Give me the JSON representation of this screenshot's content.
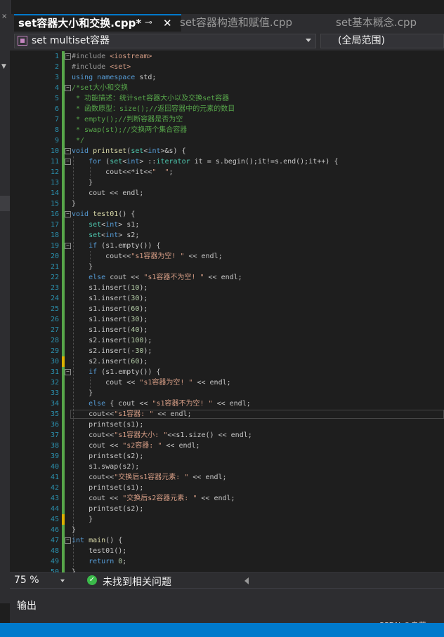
{
  "tabs": [
    {
      "label": "set容器大小和交换.cpp*",
      "active": true
    },
    {
      "label": "set容器构造和赋值.cpp",
      "active": false
    },
    {
      "label": "set基本概念.cpp",
      "active": false
    }
  ],
  "tab_pin_icon": "⊸",
  "tab_close_icon": "✕",
  "nav": {
    "scope_label": "set multiset容器",
    "global_scope": "(全局范围)"
  },
  "editor": {
    "zoom": "75 %",
    "issues_text": "未找到相关问题",
    "changed_lines": [
      30,
      45
    ],
    "current_line": 35
  },
  "code_lines": [
    [
      [
        "p",
        "#include "
      ],
      [
        "s",
        "<iostream>"
      ]
    ],
    [
      [
        "p",
        "#include "
      ],
      [
        "s",
        "<set>"
      ]
    ],
    [
      [
        "k",
        "using"
      ],
      [
        "m",
        " "
      ],
      [
        "k",
        "namespace"
      ],
      [
        "m",
        " std;"
      ]
    ],
    [
      [
        "c",
        "/*set大小和交换"
      ]
    ],
    [
      [
        "c",
        " * 功能描述：统计set容器大小以及交换set容器"
      ]
    ],
    [
      [
        "c",
        " * 函数原型：size();//返回容器中的元素的数目"
      ]
    ],
    [
      [
        "c",
        " * empty();//判断容器是否为空"
      ]
    ],
    [
      [
        "c",
        " * swap(st);//交换两个集合容器"
      ]
    ],
    [
      [
        "c",
        " */"
      ]
    ],
    [
      [
        "k",
        "void"
      ],
      [
        "m",
        " "
      ],
      [
        "f",
        "printset"
      ],
      [
        "m",
        "("
      ],
      [
        "t",
        "set"
      ],
      [
        "m",
        "<"
      ],
      [
        "k",
        "int"
      ],
      [
        "m",
        ">&s) {"
      ]
    ],
    [
      [
        "m",
        "    "
      ],
      [
        "k",
        "for"
      ],
      [
        "m",
        " ("
      ],
      [
        "t",
        "set"
      ],
      [
        "m",
        "<"
      ],
      [
        "k",
        "int"
      ],
      [
        "m",
        "> ::"
      ],
      [
        "t",
        "iterator"
      ],
      [
        "m",
        " it = s.begin();it!=s.end();it++) {"
      ]
    ],
    [
      [
        "m",
        "        cout<<*it<<"
      ],
      [
        "s",
        "\"  \""
      ],
      [
        "m",
        ";"
      ]
    ],
    [
      [
        "m",
        "    }"
      ]
    ],
    [
      [
        "m",
        "    cout << endl;"
      ]
    ],
    [
      [
        "m",
        "}"
      ]
    ],
    [
      [
        "k",
        "void"
      ],
      [
        "m",
        " "
      ],
      [
        "f",
        "test01"
      ],
      [
        "m",
        "() {"
      ]
    ],
    [
      [
        "m",
        "    "
      ],
      [
        "t",
        "set"
      ],
      [
        "m",
        "<"
      ],
      [
        "k",
        "int"
      ],
      [
        "m",
        "> s1;"
      ]
    ],
    [
      [
        "m",
        "    "
      ],
      [
        "t",
        "set"
      ],
      [
        "m",
        "<"
      ],
      [
        "k",
        "int"
      ],
      [
        "m",
        "> s2;"
      ]
    ],
    [
      [
        "m",
        "    "
      ],
      [
        "k",
        "if"
      ],
      [
        "m",
        " (s1.empty()) {"
      ]
    ],
    [
      [
        "m",
        "        cout<<"
      ],
      [
        "s",
        "\"s1容器为空! \""
      ],
      [
        "m",
        " << endl;"
      ]
    ],
    [
      [
        "m",
        "    }"
      ]
    ],
    [
      [
        "m",
        "    "
      ],
      [
        "k",
        "else"
      ],
      [
        "m",
        " cout << "
      ],
      [
        "s",
        "\"s1容器不为空! \""
      ],
      [
        "m",
        " << endl;"
      ]
    ],
    [
      [
        "m",
        "    s1.insert("
      ],
      [
        "n",
        "10"
      ],
      [
        "m",
        ");"
      ]
    ],
    [
      [
        "m",
        "    s1.insert("
      ],
      [
        "n",
        "30"
      ],
      [
        "m",
        ");"
      ]
    ],
    [
      [
        "m",
        "    s1.insert("
      ],
      [
        "n",
        "60"
      ],
      [
        "m",
        ");"
      ]
    ],
    [
      [
        "m",
        "    s1.insert("
      ],
      [
        "n",
        "30"
      ],
      [
        "m",
        ");"
      ]
    ],
    [
      [
        "m",
        "    s1.insert("
      ],
      [
        "n",
        "40"
      ],
      [
        "m",
        ");"
      ]
    ],
    [
      [
        "m",
        "    s2.insert("
      ],
      [
        "n",
        "100"
      ],
      [
        "m",
        ");"
      ]
    ],
    [
      [
        "m",
        "    s2.insert(-"
      ],
      [
        "n",
        "30"
      ],
      [
        "m",
        ");"
      ]
    ],
    [
      [
        "m",
        "    s2.insert("
      ],
      [
        "n",
        "60"
      ],
      [
        "m",
        ");"
      ]
    ],
    [
      [
        "m",
        "    "
      ],
      [
        "k",
        "if"
      ],
      [
        "m",
        " (s1.empty()) {"
      ]
    ],
    [
      [
        "m",
        "        cout << "
      ],
      [
        "s",
        "\"s1容器为空! \""
      ],
      [
        "m",
        " << endl;"
      ]
    ],
    [
      [
        "m",
        "    }"
      ]
    ],
    [
      [
        "m",
        "    "
      ],
      [
        "k",
        "else"
      ],
      [
        "m",
        " { cout << "
      ],
      [
        "s",
        "\"s1容器不为空! \""
      ],
      [
        "m",
        " << endl;"
      ]
    ],
    [
      [
        "m",
        "    cout<<"
      ],
      [
        "s",
        "\"s1容器: \""
      ],
      [
        "m",
        " << endl;"
      ]
    ],
    [
      [
        "m",
        "    printset(s1);"
      ]
    ],
    [
      [
        "m",
        "    cout<<"
      ],
      [
        "s",
        "\"s1容器大小: \""
      ],
      [
        "m",
        "<<s1.size() << endl;"
      ]
    ],
    [
      [
        "m",
        "    cout << "
      ],
      [
        "s",
        "\"s2容器: \""
      ],
      [
        "m",
        " << endl;"
      ]
    ],
    [
      [
        "m",
        "    printset(s2);"
      ]
    ],
    [
      [
        "m",
        "    s1.swap(s2);"
      ]
    ],
    [
      [
        "m",
        "    cout<<"
      ],
      [
        "s",
        "\"交换后s1容器元素: \""
      ],
      [
        "m",
        " << endl;"
      ]
    ],
    [
      [
        "m",
        "    printset(s1);"
      ]
    ],
    [
      [
        "m",
        "    cout << "
      ],
      [
        "s",
        "\"交换后s2容器元素: \""
      ],
      [
        "m",
        " << endl;"
      ]
    ],
    [
      [
        "m",
        "    printset(s2);"
      ]
    ],
    [
      [
        "m",
        "    }"
      ]
    ],
    [
      [
        "m",
        "}"
      ]
    ],
    [
      [
        "k",
        "int"
      ],
      [
        "m",
        " "
      ],
      [
        "f",
        "main"
      ],
      [
        "m",
        "() {"
      ]
    ],
    [
      [
        "m",
        "    test01();"
      ]
    ],
    [
      [
        "m",
        "    "
      ],
      [
        "k",
        "return"
      ],
      [
        "m",
        " "
      ],
      [
        "n",
        "0"
      ],
      [
        "m",
        ";"
      ]
    ],
    [
      [
        "m",
        "}"
      ]
    ]
  ],
  "folds": [
    1,
    4,
    10,
    11,
    16,
    19,
    31,
    47
  ],
  "output_panel": {
    "title": "输出"
  },
  "watermark": "CSDN @乌苏~"
}
